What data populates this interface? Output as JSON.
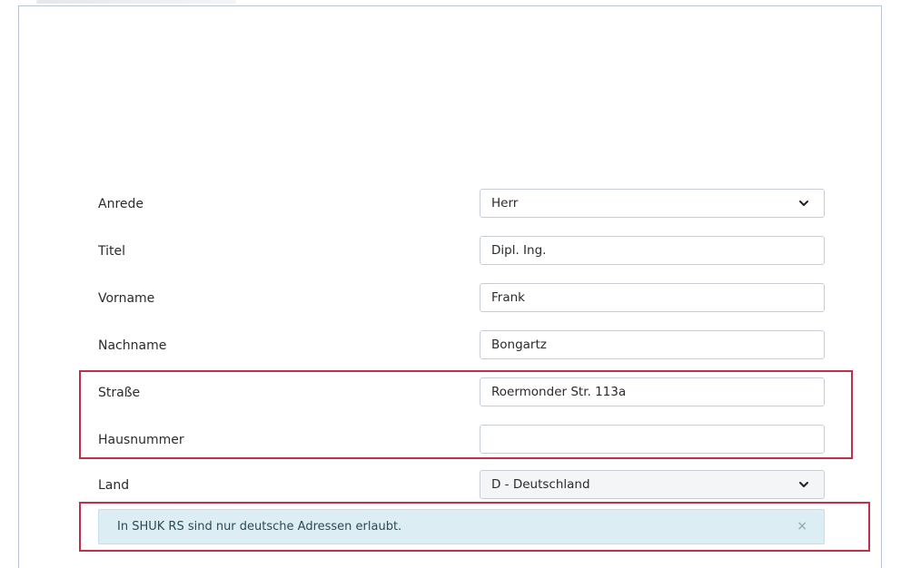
{
  "form": {
    "anrede": {
      "label": "Anrede",
      "value": "Herr"
    },
    "titel": {
      "label": "Titel",
      "value": "Dipl. Ing."
    },
    "vorname": {
      "label": "Vorname",
      "value": "Frank"
    },
    "nachname": {
      "label": "Nachname",
      "value": "Bongartz"
    },
    "strasse": {
      "label": "Straße",
      "value": "Roermonder Str. 113a"
    },
    "hausnummer": {
      "label": "Hausnummer",
      "value": ""
    },
    "land": {
      "label": "Land",
      "value": "D - Deutschland"
    }
  },
  "alert": {
    "message": "In SHUK RS sind nur deutsche Adressen erlaubt.",
    "close_glyph": "×"
  },
  "colors": {
    "highlight": "#c0304a",
    "alert_bg": "#dcedf3",
    "border": "#c9ced6"
  }
}
